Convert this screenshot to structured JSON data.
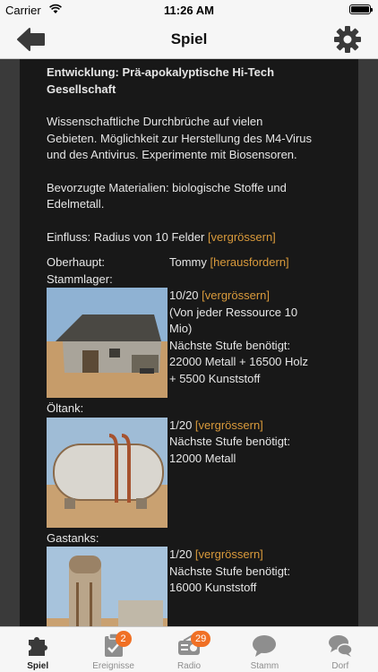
{
  "status_bar": {
    "carrier": "Carrier",
    "time": "11:26 AM"
  },
  "nav": {
    "title": "Spiel"
  },
  "content": {
    "heading": "Entwicklung: Prä-apokalyptische Hi-Tech Gesellschaft",
    "description": "Wissenschaftliche Durchbrüche auf vielen Gebieten. Möglichkeit zur Herstellung des M4-Virus und des Antivirus. Experimente mit Biosensoren.",
    "materials": "Bevorzugte Materialien: biologische Stoffe und Edelmetall.",
    "influence": {
      "text": "Einfluss: Radius von 10 Felder ",
      "link": "[vergrössern]"
    },
    "leader": {
      "label": "Oberhaupt:",
      "name": "Tommy ",
      "link": "[herausfordern]"
    },
    "buildings": [
      {
        "label": "Stammlager:",
        "level": "10/20 ",
        "link": "[vergrössern]",
        "info": "(Von jeder Ressource 10 Mio)",
        "next": "Nächste Stufe benötigt: 22000 Metall + 16500 Holz + 5500 Kunststoff"
      },
      {
        "label": "Öltank:",
        "level": "1/20 ",
        "link": "[vergrössern]",
        "next": "Nächste Stufe benötigt: 12000 Metall"
      },
      {
        "label": "Gastanks:",
        "level": "1/20 ",
        "link": "[vergrössern]",
        "next": "Nächste Stufe benötigt: 16000 Kunststoff"
      }
    ]
  },
  "tabbar": [
    {
      "label": "Spiel",
      "icon": "puzzle-icon",
      "active": true
    },
    {
      "label": "Ereignisse",
      "icon": "clipboard-icon",
      "badge": "2"
    },
    {
      "label": "Radio",
      "icon": "radio-icon",
      "badge": "29"
    },
    {
      "label": "Stamm",
      "icon": "chat-bubble-icon"
    },
    {
      "label": "Dorf",
      "icon": "chat-bubbles-icon"
    }
  ],
  "colors": {
    "link": "#d99a3b",
    "badge": "#f07025",
    "panel": "#181818"
  }
}
